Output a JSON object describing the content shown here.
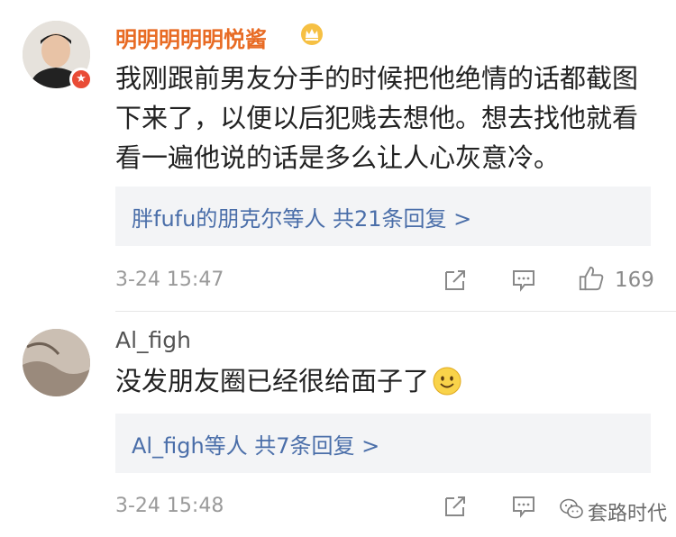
{
  "comments": [
    {
      "username": "明明明明明悦酱",
      "body": "我刚跟前男友分手的时候把他绝情的话都截图下来了，以便以后犯贱去想他。想去找他就看看一遍他说的话是多么让人心灰意冷。",
      "replies_summary": "胖fufu的朋克尔等人  共21条回复 >",
      "timestamp": "3-24 15:47",
      "likes": "169",
      "badge": "★"
    },
    {
      "username": "Al_figh",
      "body": "没发朋友圈已经很给面子了",
      "replies_summary": "Al_figh等人  共7条回复 >",
      "timestamp": "3-24 15:48"
    }
  ],
  "watermark": {
    "text": "套路时代"
  },
  "colors": {
    "username_orange": "#e86b24",
    "link_blue": "#4a6ea9",
    "reply_bg": "#f3f4f6",
    "meta_gray": "#9a9a9a"
  },
  "icons": [
    "verified-badge-icon",
    "crown-icon",
    "share-icon",
    "reply-icon",
    "like-icon",
    "smiley-emoji-icon",
    "wechat-icon"
  ]
}
